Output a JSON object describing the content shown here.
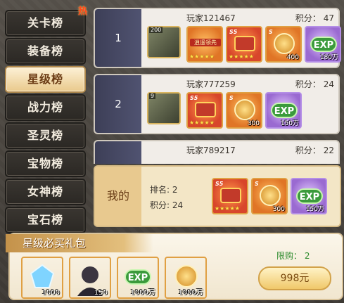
{
  "sidebar": {
    "tabs": [
      {
        "label": "关卡榜",
        "hot": true
      },
      {
        "label": "装备榜"
      },
      {
        "label": "星级榜",
        "active": true
      },
      {
        "label": "战力榜"
      },
      {
        "label": "圣灵榜"
      },
      {
        "label": "宝物榜"
      },
      {
        "label": "女神榜"
      },
      {
        "label": "宝石榜"
      }
    ],
    "hot_badge": "热"
  },
  "ranking": {
    "rows": [
      {
        "rank": "1",
        "name": "玩家121467",
        "score": "积分： 47",
        "level": "200",
        "items": [
          {
            "kind": "box-tag",
            "tag": "逍遥领先",
            "color": "orange"
          },
          {
            "kind": "chest",
            "color": "red",
            "badge": "S5"
          },
          {
            "kind": "coin",
            "color": "orange",
            "count": "400",
            "badge": "S"
          },
          {
            "kind": "exp",
            "color": "purple",
            "count": "180万"
          }
        ]
      },
      {
        "rank": "2",
        "name": "玩家777259",
        "score": "积分： 24",
        "level": "9",
        "items": [
          {
            "kind": "chest",
            "color": "red",
            "badge": "S5"
          },
          {
            "kind": "coin",
            "color": "orange",
            "count": "300",
            "badge": "S"
          },
          {
            "kind": "exp",
            "color": "purple",
            "count": "150万"
          }
        ]
      },
      {
        "rank": "",
        "name": "玩家789217",
        "score": "积分： 22",
        "level": "",
        "items": []
      }
    ]
  },
  "mine": {
    "label": "我的",
    "rank": "排名: 2",
    "score": "积分: 24",
    "items": [
      {
        "kind": "chest",
        "color": "red",
        "badge": "S5"
      },
      {
        "kind": "coin",
        "color": "orange",
        "count": "300",
        "badge": "S"
      },
      {
        "kind": "exp",
        "color": "purple",
        "count": "150万"
      }
    ]
  },
  "pack": {
    "title": "星级必买礼包",
    "limit": "限购： 2",
    "price": "998元",
    "items": [
      {
        "kind": "gem",
        "color": "blue",
        "count": "1000"
      },
      {
        "kind": "hero",
        "color": "orange",
        "count": "150"
      },
      {
        "kind": "exp",
        "color": "purple",
        "count": "1000万"
      },
      {
        "kind": "coin",
        "color": "purple",
        "count": "1000万"
      }
    ]
  },
  "icons": {
    "exp_text": "EXP",
    "stars": "★★★★★"
  },
  "colors": {
    "accent_gold": "#e9c98c",
    "rank_panel": "#3d3f57",
    "limit_green": "#2e8b2e"
  }
}
